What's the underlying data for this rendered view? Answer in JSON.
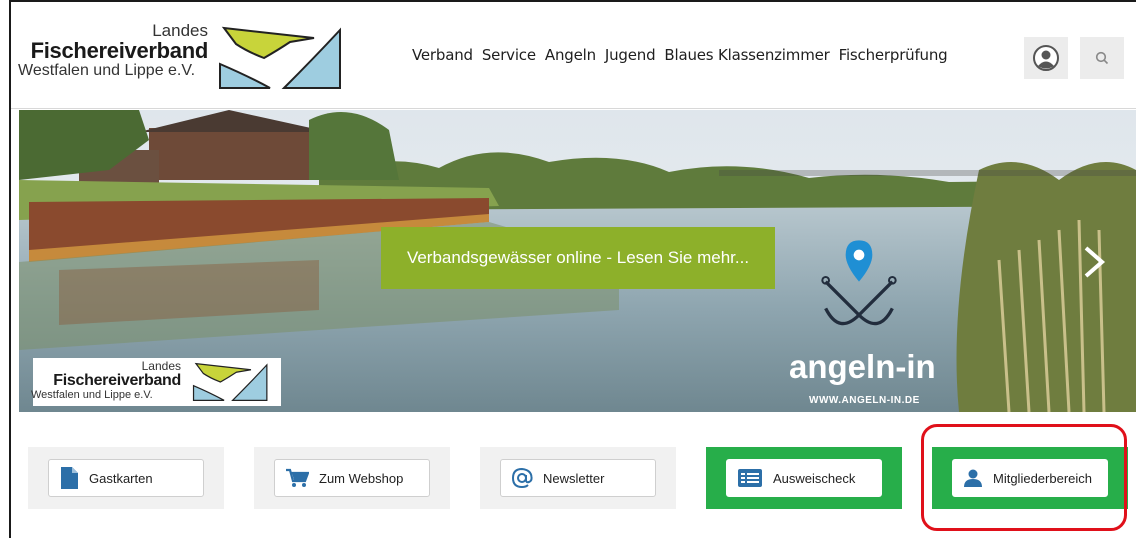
{
  "logo": {
    "line1": "Landes",
    "line2": "Fischereiverband",
    "line3": "Westfalen und Lippe e.V."
  },
  "nav": {
    "items": [
      "Verband",
      "Service",
      "Angeln",
      "Jugend",
      "Blaues Klassenzimmer",
      "Fischerprüfung"
    ]
  },
  "icons": {
    "account": "account-icon",
    "search": "search-icon"
  },
  "slider": {
    "caption": "Verbandsgewässer online - Lesen Sie mehr...",
    "brand_word": "angeln-in",
    "brand_url": "WWW.ANGELN-IN.DE",
    "logo": {
      "line1": "Landes",
      "line2": "Fischereiverband",
      "line3": "Westfalen und Lippe e.V."
    }
  },
  "tiles": [
    {
      "label": "Gastkarten",
      "icon": "document-icon",
      "style": "gray"
    },
    {
      "label": "Zum Webshop",
      "icon": "cart-icon",
      "style": "gray"
    },
    {
      "label": "Newsletter",
      "icon": "at-icon",
      "style": "gray"
    },
    {
      "label": "Ausweischeck",
      "icon": "id-card-icon",
      "style": "green"
    },
    {
      "label": "Mitgliederbereich",
      "icon": "user-icon",
      "style": "green"
    }
  ],
  "colors": {
    "caption_bg": "#8db02a",
    "tile_green": "#27ae4a",
    "highlight": "#e0101a",
    "logo_yellow": "#c8d43a",
    "logo_blue": "#9ecde0"
  }
}
